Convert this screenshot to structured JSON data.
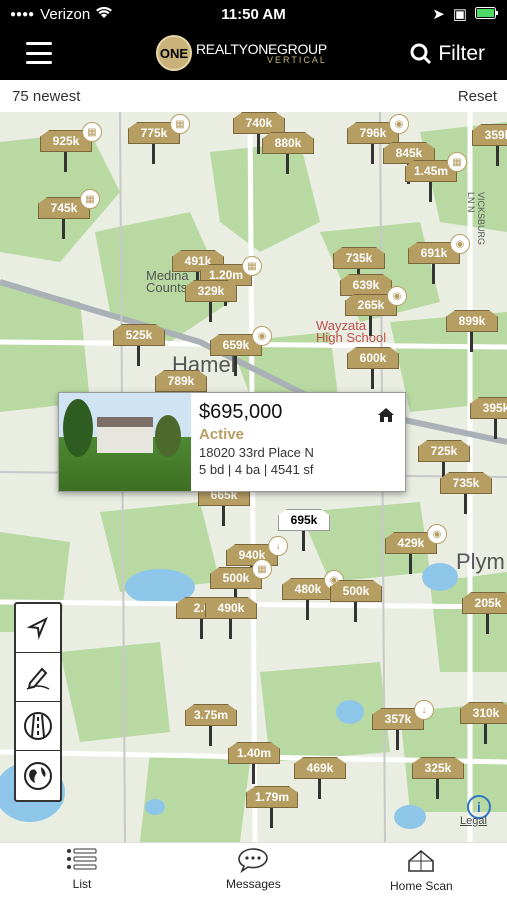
{
  "status_bar": {
    "carrier": "Verizon",
    "time": "11:50 AM"
  },
  "header": {
    "logo": {
      "badge": "ONE",
      "wordmark": "REALTYONEGROUP",
      "sub": "VERTICAL"
    },
    "filter_label": "Filter"
  },
  "subbar": {
    "count_label": "75 newest",
    "reset_label": "Reset"
  },
  "map": {
    "place_labels": [
      "Medina",
      "Counts",
      "Wayzata",
      "High School",
      "Hamel",
      "Plym"
    ],
    "street_label": "VICKSBURG LN N",
    "legal": "Legal",
    "pins": [
      {
        "label": "925k"
      },
      {
        "label": "775k"
      },
      {
        "label": "740k"
      },
      {
        "label": "880k"
      },
      {
        "label": "796k"
      },
      {
        "label": "845k"
      },
      {
        "label": "1.45m"
      },
      {
        "label": "359k"
      },
      {
        "label": "745k"
      },
      {
        "label": "491k"
      },
      {
        "label": "1.20m"
      },
      {
        "label": "329k"
      },
      {
        "label": "735k"
      },
      {
        "label": "691k"
      },
      {
        "label": "639k"
      },
      {
        "label": "265k"
      },
      {
        "label": "525k"
      },
      {
        "label": "899k"
      },
      {
        "label": "659k"
      },
      {
        "label": "600k"
      },
      {
        "label": "789k"
      },
      {
        "label": "395k"
      },
      {
        "label": "725k"
      },
      {
        "label": "735k"
      },
      {
        "label": "665k"
      },
      {
        "label": "695k"
      },
      {
        "label": "429k"
      },
      {
        "label": "940k"
      },
      {
        "label": "500k"
      },
      {
        "label": "480k"
      },
      {
        "label": "500k"
      },
      {
        "label": "205k"
      },
      {
        "label": "2.0"
      },
      {
        "label": "490k"
      },
      {
        "label": "3.75m"
      },
      {
        "label": "357k"
      },
      {
        "label": "310k"
      },
      {
        "label": "1.40m"
      },
      {
        "label": "469k"
      },
      {
        "label": "325k"
      },
      {
        "label": "1.79m"
      }
    ]
  },
  "popup": {
    "price": "$695,000",
    "status": "Active",
    "address": "18020 33rd Place N",
    "specs": "5 bd | 4 ba | 4541 sf"
  },
  "tools": [
    {
      "icon": "location-arrow-icon"
    },
    {
      "icon": "pencil-draw-icon"
    },
    {
      "icon": "road-icon"
    },
    {
      "icon": "globe-icon"
    }
  ],
  "tabs": [
    {
      "label": "List",
      "icon": "list-icon"
    },
    {
      "label": "Messages",
      "icon": "messages-icon"
    },
    {
      "label": "Home Scan",
      "icon": "home-scan-icon"
    }
  ],
  "colors": {
    "pin": "#b69e63",
    "active": "#b69e63",
    "header": "#000000"
  }
}
